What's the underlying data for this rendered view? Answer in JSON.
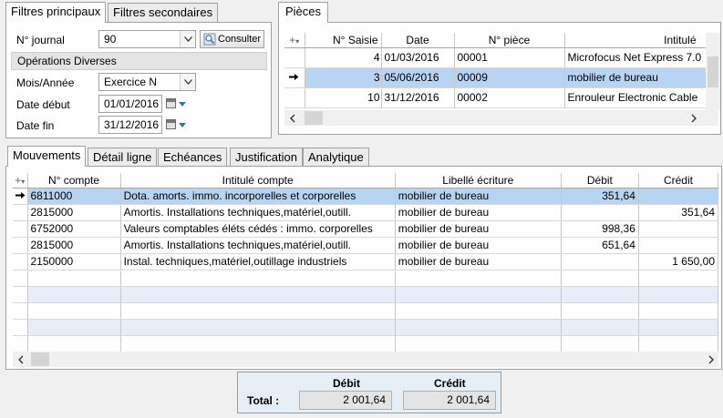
{
  "filters": {
    "tabs": [
      "Filtres principaux",
      "Filtres secondaires"
    ],
    "journal_label": "N° journal",
    "journal_value": "90",
    "consult_button": "Consulter",
    "journal_name": "Opérations Diverses",
    "period_label": "Mois/Année",
    "period_value": "Exercice N",
    "start_label": "Date début",
    "start_value": "01/01/2016",
    "end_label": "Date fin",
    "end_value": "31/12/2016"
  },
  "pieces": {
    "tab": "Pièces",
    "columns": [
      "N° Saisie",
      "Date",
      "N° pièce",
      "Intitulé"
    ],
    "rows": [
      {
        "saisie": "4",
        "date": "01/03/2016",
        "piece": "00001",
        "intitule": "Microfocus Net Express 7.0"
      },
      {
        "saisie": "3",
        "date": "05/06/2016",
        "piece": "00009",
        "intitule": "mobilier de bureau"
      },
      {
        "saisie": "10",
        "date": "31/12/2016",
        "piece": "00002",
        "intitule": "Enrouleur Electronic Cable"
      }
    ],
    "selected_row": 1
  },
  "details": {
    "tabs": [
      "Mouvements",
      "Détail ligne",
      "Echéances",
      "Justification",
      "Analytique"
    ],
    "columns": [
      "N° compte",
      "Intitulé compte",
      "Libellé écriture",
      "Débit",
      "Crédit"
    ],
    "rows": [
      {
        "compte": "6811000",
        "intitule": "Dota. amorts. immo. incorporelles et corporelles",
        "libelle": "mobilier de bureau",
        "debit": "351,64",
        "credit": ""
      },
      {
        "compte": "2815000",
        "intitule": "Amortis. Installations techniques,matériel,outill.",
        "libelle": "mobilier de bureau",
        "debit": "",
        "credit": "351,64"
      },
      {
        "compte": "6752000",
        "intitule": "Valeurs comptables éléts cédés : immo. corporelles",
        "libelle": "mobilier de bureau",
        "debit": "998,36",
        "credit": ""
      },
      {
        "compte": "2815000",
        "intitule": "Amortis. Installations techniques,matériel,outill.",
        "libelle": "mobilier de bureau",
        "debit": "651,64",
        "credit": ""
      },
      {
        "compte": "2150000",
        "intitule": "Instal. techniques,matériel,outillage industriels",
        "libelle": "mobilier de bureau",
        "debit": "",
        "credit": "1 650,00"
      }
    ],
    "selected_row": 0
  },
  "totals": {
    "debit_label": "Débit",
    "credit_label": "Crédit",
    "total_label": "Total :",
    "debit_value": "2 001,64",
    "credit_value": "2 001,64"
  },
  "colors": {
    "selection": "#b8d4f3",
    "alt_row": "#e7eef7",
    "icon_accent": "#3c6fb5"
  }
}
